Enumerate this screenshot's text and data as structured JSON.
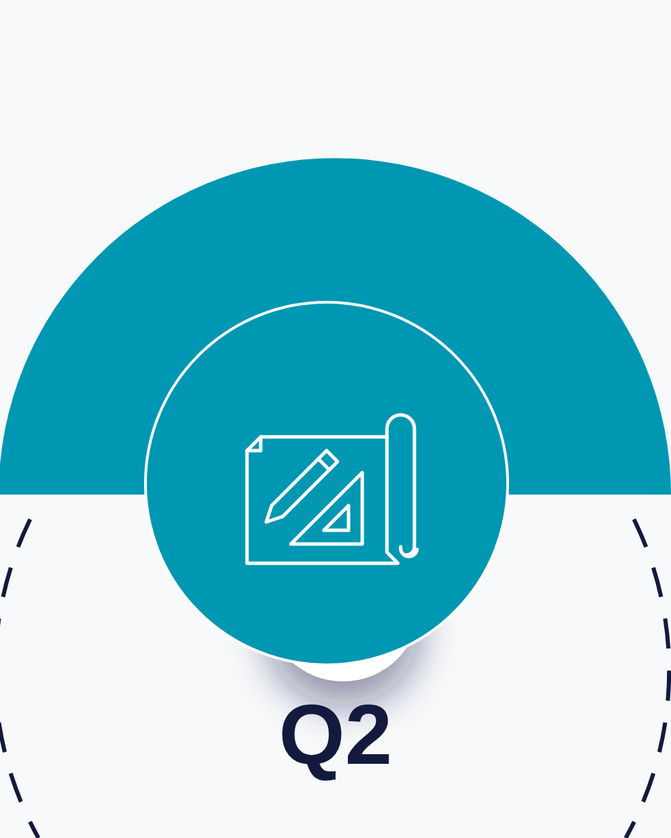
{
  "step": {
    "label": "Q2"
  }
}
